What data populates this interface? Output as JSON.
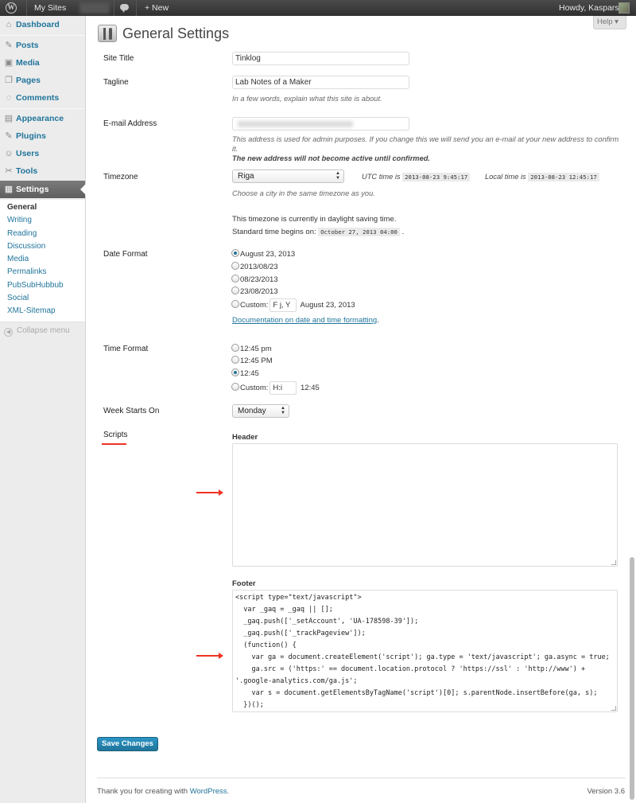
{
  "adminbar": {
    "my_sites": "My Sites",
    "new": "+ New",
    "howdy": "Howdy, Kaspars"
  },
  "help": {
    "label": "Help ▾"
  },
  "sidebar": {
    "items": [
      {
        "label": "Dashboard",
        "icon": "dashboard-icon",
        "glyph": "⌂"
      },
      {
        "label": "Posts",
        "icon": "pin-icon",
        "glyph": "✎"
      },
      {
        "label": "Media",
        "icon": "media-icon",
        "glyph": "▣"
      },
      {
        "label": "Pages",
        "icon": "pages-icon",
        "glyph": "❐"
      },
      {
        "label": "Comments",
        "icon": "comments-icon",
        "glyph": "◌"
      },
      {
        "label": "Appearance",
        "icon": "appearance-icon",
        "glyph": "▤"
      },
      {
        "label": "Plugins",
        "icon": "plugins-icon",
        "glyph": "✎"
      },
      {
        "label": "Users",
        "icon": "users-icon",
        "glyph": "☺"
      },
      {
        "label": "Tools",
        "icon": "tools-icon",
        "glyph": "✂"
      },
      {
        "label": "Settings",
        "icon": "settings-icon",
        "glyph": "▦"
      }
    ],
    "submenu": [
      "General",
      "Writing",
      "Reading",
      "Discussion",
      "Media",
      "Permalinks",
      "PubSubHubbub",
      "Social",
      "XML-Sitemap"
    ],
    "collapse": "Collapse menu"
  },
  "page": {
    "title": "General Settings"
  },
  "settings": {
    "site_title": {
      "label": "Site Title",
      "value": "Tinklog"
    },
    "tagline": {
      "label": "Tagline",
      "value": "Lab Notes of a Maker",
      "desc": "In a few words, explain what this site is about."
    },
    "email": {
      "label": "E-mail Address",
      "desc": "This address is used for admin purposes. If you change this we will send you an e-mail at your new address to confirm it.",
      "desc_bold": "The new address will not become active until confirmed."
    },
    "timezone": {
      "label": "Timezone",
      "value": "Riga",
      "utc_label": "UTC time is",
      "utc_value": "2013-08-23 9:45:17",
      "local_label": "Local time is",
      "local_value": "2013-08-23 12:45:17",
      "desc": "Choose a city in the same timezone as you.",
      "dst_note": "This timezone is currently in daylight saving time.",
      "standard_begins": "Standard time begins on:",
      "standard_value": "October 27, 2013 04:00",
      "standard_end": "."
    },
    "date_format": {
      "label": "Date Format",
      "options": [
        "August 23, 2013",
        "2013/08/23",
        "08/23/2013",
        "23/08/2013"
      ],
      "custom_label": "Custom:",
      "custom_value": "F j, Y",
      "custom_preview": "August 23, 2013",
      "doc_link": "Documentation on date and time formatting",
      "doc_end": "."
    },
    "time_format": {
      "label": "Time Format",
      "options": [
        "12:45 pm",
        "12:45 PM",
        "12:45"
      ],
      "custom_label": "Custom:",
      "custom_value": "H:i",
      "custom_preview": "12:45"
    },
    "week_starts": {
      "label": "Week Starts On",
      "value": "Monday"
    },
    "scripts": {
      "label": "Scripts",
      "header_label": "Header",
      "header_value": "",
      "footer_label": "Footer",
      "footer_value": "<script type=\"text/javascript\">\n  var _gaq = _gaq || [];\n  _gaq.push(['_setAccount', 'UA-178598-39']);\n  _gaq.push(['_trackPageview']);\n  (function() {\n    var ga = document.createElement('script'); ga.type = 'text/javascript'; ga.async = true;\n    ga.src = ('https:' == document.location.protocol ? 'https://ssl' : 'http://www') +\n'.google-analytics.com/ga.js';\n    var s = document.getElementsByTagName('script')[0]; s.parentNode.insertBefore(ga, s);\n  })();"
    }
  },
  "save_button": "Save Changes",
  "footer": {
    "thanks_prefix": "Thank you for creating with",
    "wordpress_link": "WordPress",
    "thanks_suffix": ".",
    "version": "Version 3.6"
  },
  "colors": {
    "accent": "#21759b",
    "annotation_red": "#e32"
  }
}
